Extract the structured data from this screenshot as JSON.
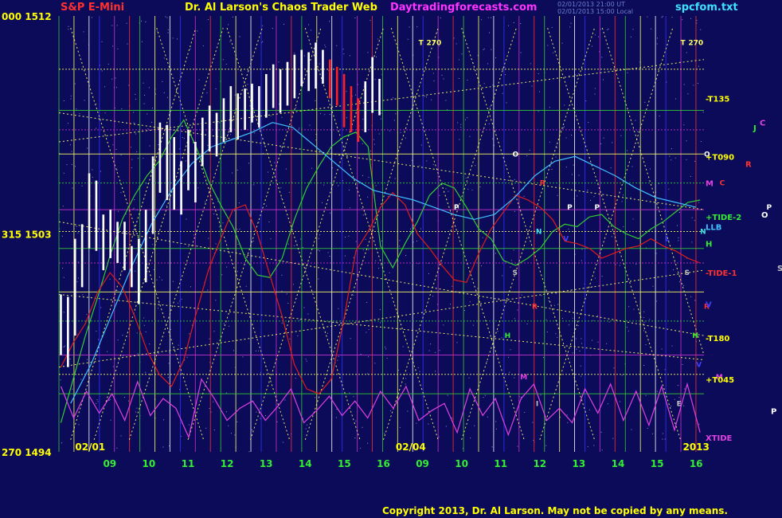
{
  "header": {
    "symbol": "S&P E-Mini",
    "title": "Dr. Al Larson's Chaos Trader Web",
    "site": "Daytradingforecasts.com",
    "stamp1": "02/01/2013 21:00 UT",
    "stamp2": "02/01/2013 15:00 Local",
    "file": "spcfom.txt"
  },
  "colors": {
    "background": "#0b0b5a",
    "price_bar": "#ffffff",
    "grid_yellow": "#ffff66",
    "grid_green": "#33cc33",
    "tide2": "#33cc33",
    "tide1": "#e01c1c",
    "llb": "#40c0ff",
    "xtide": "#e040e0",
    "magenta_line": "#cc33cc"
  },
  "copyright": "Copyright 2013, Dr. Al Larson. May not be copied by any means.",
  "chart_data": {
    "type": "bar",
    "title": "S&P E-Mini",
    "y_axis_labels": [
      {
        "label": "000 1512",
        "value": 1512
      },
      {
        "label": "315 1503",
        "value": 1503
      },
      {
        "label": "270 1494",
        "value": 1494
      }
    ],
    "ylim": [
      1494,
      1512
    ],
    "x_tick_labels": [
      "09",
      "10",
      "11",
      "12",
      "13",
      "14",
      "15",
      "16",
      "09",
      "10",
      "11",
      "12",
      "13",
      "14",
      "15",
      "16"
    ],
    "date_labels": [
      "02/01",
      "02/04"
    ],
    "year_label": "2013",
    "price_bars": [
      [
        0,
        1498.0,
        1500.5
      ],
      [
        1,
        1497.5,
        1500.4
      ],
      [
        2,
        1498.8,
        1502.8
      ],
      [
        3,
        1500.8,
        1503.4
      ],
      [
        4,
        1502.4,
        1505.5
      ],
      [
        5,
        1502.3,
        1505.2
      ],
      [
        6,
        1501.5,
        1503.8
      ],
      [
        7,
        1502.0,
        1504.0
      ],
      [
        8,
        1501.8,
        1503.5
      ],
      [
        9,
        1501.5,
        1503.5
      ],
      [
        10,
        1500.8,
        1502.5
      ],
      [
        11,
        1500.1,
        1502.8
      ],
      [
        12,
        1501.0,
        1504.0
      ],
      [
        13,
        1503.0,
        1506.2
      ],
      [
        14,
        1504.7,
        1507.6
      ],
      [
        15,
        1504.4,
        1507.5
      ],
      [
        16,
        1504.0,
        1507.0
      ],
      [
        17,
        1503.8,
        1506.0
      ],
      [
        18,
        1504.8,
        1507.3
      ],
      [
        19,
        1504.3,
        1506.8
      ],
      [
        20,
        1505.8,
        1507.8
      ],
      [
        21,
        1506.4,
        1508.3
      ],
      [
        22,
        1506.2,
        1508.0
      ],
      [
        23,
        1506.8,
        1508.6
      ],
      [
        24,
        1507.2,
        1509.1
      ],
      [
        25,
        1506.9,
        1508.8
      ],
      [
        26,
        1507.3,
        1509.0
      ],
      [
        27,
        1507.6,
        1509.2
      ],
      [
        28,
        1507.4,
        1509.1
      ],
      [
        29,
        1507.8,
        1509.6
      ],
      [
        30,
        1508.2,
        1510.0
      ],
      [
        31,
        1508.0,
        1509.8
      ],
      [
        32,
        1508.3,
        1510.1
      ],
      [
        33,
        1508.6,
        1510.4
      ],
      [
        34,
        1509.1,
        1510.6
      ],
      [
        35,
        1508.9,
        1510.5
      ],
      [
        36,
        1509.0,
        1510.9
      ],
      [
        37,
        1509.2,
        1510.6
      ],
      [
        38,
        1508.6,
        1510.2
      ],
      [
        39,
        1508.3,
        1509.9
      ],
      [
        40,
        1507.4,
        1509.6
      ],
      [
        41,
        1507.2,
        1509.1
      ],
      [
        42,
        1506.8,
        1508.6
      ],
      [
        43,
        1507.2,
        1509.3
      ],
      [
        44,
        1508.0,
        1510.3
      ],
      [
        45,
        1507.9,
        1509.4
      ]
    ],
    "series": [
      {
        "name": "+TIDE-2",
        "values": [
          1495.2,
          1497.0,
          1498.8,
          1500.4,
          1502.1,
          1503.6,
          1504.6,
          1505.4,
          1506.0,
          1507.0,
          1507.7,
          1506.6,
          1505.2,
          1504.2,
          1503.3,
          1502.0,
          1501.3,
          1501.2,
          1502.0,
          1503.6,
          1504.9,
          1505.8,
          1506.6,
          1507.0,
          1507.2,
          1506.6,
          1502.5,
          1501.6,
          1502.6,
          1503.5,
          1504.6,
          1505.1,
          1504.9,
          1504.1,
          1503.2,
          1502.8,
          1501.9,
          1501.7,
          1502.0,
          1502.4,
          1503.1,
          1503.4,
          1503.3,
          1503.7,
          1503.8,
          1503.3,
          1503.0,
          1502.8,
          1503.2,
          1503.5,
          1503.9,
          1504.3,
          1504.4
        ]
      },
      {
        "name": "-TIDE-1",
        "values": [
          1497.5,
          1498.5,
          1499.3,
          1500.6,
          1501.4,
          1500.8,
          1499.6,
          1498.2,
          1497.2,
          1496.7,
          1497.8,
          1499.7,
          1501.5,
          1502.8,
          1504.0,
          1504.2,
          1503.0,
          1501.3,
          1499.6,
          1497.6,
          1496.6,
          1496.4,
          1497.0,
          1499.4,
          1502.3,
          1503.1,
          1504.1,
          1504.7,
          1504.2,
          1503.0,
          1502.4,
          1501.7,
          1501.1,
          1501.0,
          1502.2,
          1503.2,
          1503.9,
          1504.6,
          1504.4,
          1504.1,
          1503.6,
          1502.7,
          1502.6,
          1502.4,
          1502.0,
          1502.2,
          1502.4,
          1502.5,
          1502.8,
          1502.5,
          1502.3,
          1502.0,
          1501.8
        ]
      },
      {
        "name": "LLB",
        "values": [
          1496.0,
          1497.6,
          1499.6,
          1501.6,
          1503.4,
          1504.8,
          1505.9,
          1506.6,
          1506.9,
          1507.2,
          1507.6,
          1507.4,
          1506.7,
          1506.0,
          1505.3,
          1504.8,
          1504.6,
          1504.4,
          1504.1,
          1503.8,
          1503.6,
          1503.8,
          1504.5,
          1505.4,
          1506.0,
          1506.2,
          1505.8,
          1505.4,
          1504.9,
          1504.5,
          1504.3,
          1504.1
        ]
      },
      {
        "name": "XTIDE",
        "values": [
          1496.7,
          1495.4,
          1496.5,
          1495.6,
          1496.4,
          1495.3,
          1496.9,
          1495.5,
          1496.2,
          1495.8,
          1494.6,
          1497.0,
          1496.2,
          1495.3,
          1495.8,
          1496.1,
          1495.3,
          1495.9,
          1496.6,
          1495.2,
          1495.7,
          1496.3,
          1495.5,
          1496.1,
          1495.4,
          1496.5,
          1495.8,
          1496.7,
          1495.3,
          1495.7,
          1496.0,
          1494.8,
          1496.6,
          1495.5,
          1496.2,
          1494.7,
          1496.2,
          1496.8,
          1495.3,
          1495.8,
          1495.2,
          1496.6,
          1495.6,
          1496.8,
          1495.3,
          1496.5,
          1495.1,
          1496.7,
          1494.9,
          1496.8,
          1494.8
        ]
      }
    ],
    "right_labels": [
      {
        "text": "-T135",
        "value": 1508.6,
        "color": "#ffff00"
      },
      {
        "text": "+T090",
        "value": 1506.2,
        "color": "#ffff00"
      },
      {
        "text": "M",
        "value": 1505.1,
        "color": "#e040e0"
      },
      {
        "text": "+TIDE-2",
        "value": 1503.7,
        "color": "#33ee33"
      },
      {
        "text": "LLB",
        "value": 1503.3,
        "color": "#40c0ff"
      },
      {
        "text": "H",
        "value": 1502.6,
        "color": "#33ee33"
      },
      {
        "text": "-TIDE-1",
        "value": 1501.4,
        "color": "#ff3030"
      },
      {
        "text": "V",
        "value": 1500.1,
        "color": "#4040ff"
      },
      {
        "text": "-T180",
        "value": 1498.7,
        "color": "#ffff00"
      },
      {
        "text": "+T045",
        "value": 1497.0,
        "color": "#ffff00"
      },
      {
        "text": "XTIDE",
        "value": 1494.6,
        "color": "#e040e0"
      }
    ],
    "planet_labels": [
      {
        "text": "C",
        "value": 1507.6,
        "offset": 70,
        "color": "#e040e0"
      },
      {
        "text": "J",
        "value": 1507.4,
        "offset": 62,
        "color": "#33ee33"
      },
      {
        "text": "N",
        "value": 1506.0,
        "offset": 100,
        "color": "#40e0e0"
      },
      {
        "text": "R",
        "value": 1505.9,
        "offset": 52,
        "color": "#ff3030"
      },
      {
        "text": "O",
        "value": 1503.8,
        "offset": 72,
        "color": "#ffffff"
      },
      {
        "text": "S",
        "value": 1501.6,
        "offset": 92,
        "color": "#c0c0c0"
      },
      {
        "text": "P",
        "value": 1495.7,
        "offset": 84,
        "color": "#ffffff"
      },
      {
        "text": "U",
        "value": 1495.2,
        "offset": 112,
        "color": "#4040ff"
      }
    ],
    "chart_letters": [
      {
        "text": "T",
        "x": 16.9,
        "value": 1510.8,
        "color": "#ffff66"
      },
      {
        "text": "270",
        "x": 17.1,
        "value": 1510.8,
        "color": "#ffff66"
      },
      {
        "text": "T",
        "x": 23.6,
        "value": 1510.8,
        "color": "#ffff66"
      },
      {
        "text": "270",
        "x": 23.8,
        "value": 1510.8,
        "color": "#ffff66"
      },
      {
        "text": "O",
        "x": 19.3,
        "value": 1506.2,
        "color": "#ffffff"
      },
      {
        "text": "O",
        "x": 24.2,
        "value": 1506.2,
        "color": "#ffffff"
      },
      {
        "text": "P",
        "x": 17.8,
        "value": 1504.0,
        "color": "#ffffff"
      },
      {
        "text": "P",
        "x": 20.7,
        "value": 1504.0,
        "color": "#ffffff"
      },
      {
        "text": "P",
        "x": 21.4,
        "value": 1504.0,
        "color": "#ffffff"
      },
      {
        "text": "P",
        "x": 25.8,
        "value": 1504.0,
        "color": "#ffffff"
      },
      {
        "text": "R",
        "x": 20.0,
        "value": 1505.0,
        "color": "#ff3030"
      },
      {
        "text": "C",
        "x": 24.6,
        "value": 1505.0,
        "color": "#ff3030"
      },
      {
        "text": "N",
        "x": 19.9,
        "value": 1503.0,
        "color": "#40e0e0"
      },
      {
        "text": "N",
        "x": 24.1,
        "value": 1503.0,
        "color": "#40e0e0"
      },
      {
        "text": "V",
        "x": 20.6,
        "value": 1502.7,
        "color": "#4040ff"
      },
      {
        "text": "V",
        "x": 24.0,
        "value": 1497.5,
        "color": "#4040ff"
      },
      {
        "text": "S",
        "x": 19.3,
        "value": 1501.3,
        "color": "#c0c0c0"
      },
      {
        "text": "S",
        "x": 23.7,
        "value": 1501.3,
        "color": "#c0c0c0"
      },
      {
        "text": "R",
        "x": 19.8,
        "value": 1499.9,
        "color": "#ff3030"
      },
      {
        "text": "R",
        "x": 24.2,
        "value": 1499.9,
        "color": "#ff3030"
      },
      {
        "text": "H",
        "x": 19.1,
        "value": 1498.7,
        "color": "#33ee33"
      },
      {
        "text": "H",
        "x": 23.9,
        "value": 1498.7,
        "color": "#33ee33"
      },
      {
        "text": "M",
        "x": 19.5,
        "value": 1497.0,
        "color": "#e040e0"
      },
      {
        "text": "M",
        "x": 24.5,
        "value": 1497.0,
        "color": "#e040e0"
      },
      {
        "text": "I",
        "x": 19.9,
        "value": 1495.9,
        "color": "#c0c0c0"
      },
      {
        "text": "E",
        "x": 23.5,
        "value": 1495.9,
        "color": "#c0c0c0"
      },
      {
        "text": "L",
        "x": 23.2,
        "value": 1502.7,
        "color": "#4040ff"
      }
    ]
  }
}
